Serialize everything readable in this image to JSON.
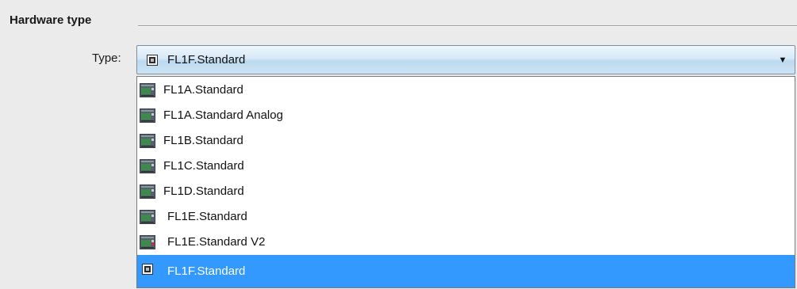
{
  "section": {
    "title": "Hardware type"
  },
  "type_field": {
    "label": "Type:",
    "selected_value": "FL1F.Standard",
    "selected_icon": "chip-icon"
  },
  "options": [
    {
      "label": "FL1A.Standard",
      "icon": "board-icon"
    },
    {
      "label": "FL1A.Standard Analog",
      "icon": "board-icon"
    },
    {
      "label": "FL1B.Standard",
      "icon": "board-icon"
    },
    {
      "label": "FL1C.Standard",
      "icon": "board-icon"
    },
    {
      "label": "FL1D.Standard",
      "icon": "board-icon"
    },
    {
      "label": "FL1E.Standard",
      "icon": "board-icon"
    },
    {
      "label": "FL1E.Standard V2",
      "icon": "board-red-dot-icon"
    },
    {
      "label": "FL1F.Standard",
      "icon": "chip-icon",
      "selected": true
    }
  ],
  "colors": {
    "selection": "#3399ff",
    "background": "#ebebeb",
    "board_green": "#3e8a4a"
  }
}
